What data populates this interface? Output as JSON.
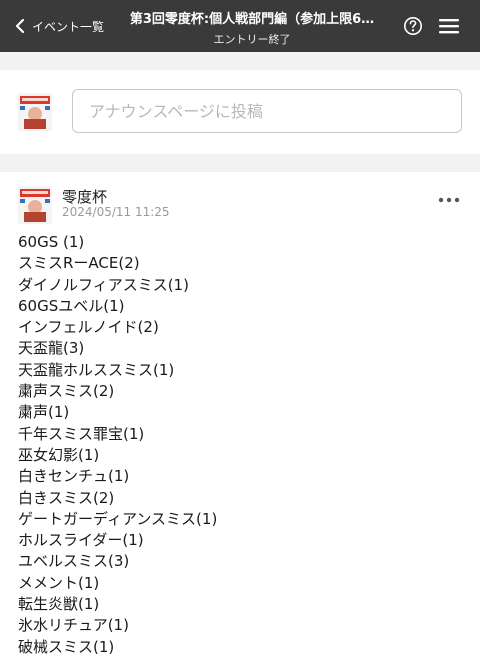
{
  "header": {
    "back_label": "イベント一覧",
    "title": "第3回零度杯:個人戦部門編（参加上限6…",
    "subtitle": "エントリー終了"
  },
  "composer": {
    "placeholder": "アナウンスページに投稿"
  },
  "post": {
    "author": "零度杯",
    "timestamp": "2024/05/11 11:25",
    "entries": [
      "60GS (1)",
      "スミスRーACE(2)",
      "ダイノルフィアスミス(1)",
      "60GSユベル(1)",
      "インフェルノイド(2)",
      "天盃龍(3)",
      "天盃龍ホルススミス(1)",
      "粛声スミス(2)",
      "粛声(1)",
      "千年スミス罪宝(1)",
      "巫女幻影(1)",
      "白きセンチュ(1)",
      "白きスミス(2)",
      "ゲートガーディアンスミス(1)",
      "ホルスライダー(1)",
      "ユベルスミス(3)",
      "メメント(1)",
      "転生炎獣(1)",
      "氷水リチュア(1)",
      "破械スミス(1)"
    ]
  },
  "icons": {
    "back": "chevron-left-icon",
    "help": "help-circle-icon",
    "menu": "hamburger-menu-icon",
    "more": "more-horizontal-icon",
    "avatar": "event-logo-avatar"
  },
  "colors": {
    "topbar": "#3a3a3a",
    "page_background": "#f2f2f2",
    "card": "#ffffff",
    "timestamp": "#9a9a9a"
  }
}
